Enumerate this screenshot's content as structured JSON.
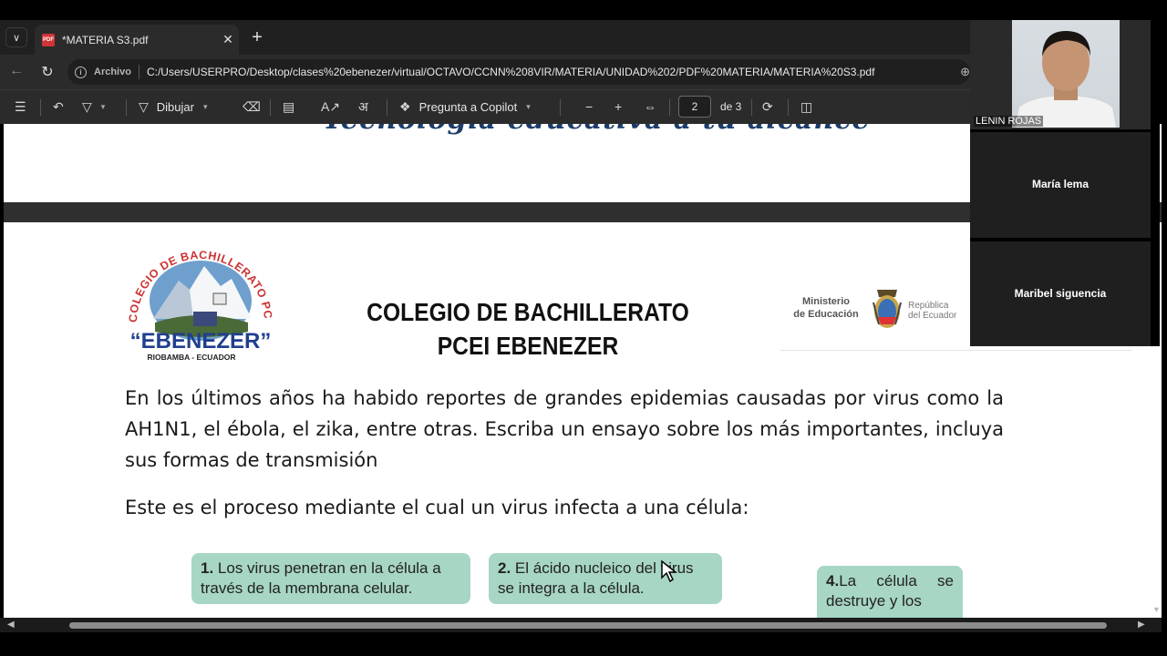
{
  "browser": {
    "tab_title": "*MATERIA S3.pdf",
    "pdf_favicon_text": "PDF",
    "url_scheme": "Archivo",
    "url": "C:/Users/USERPRO/Desktop/clases%20ebenezer/virtual/OCTAVO/CCNN%208VIR/MATERIA/UNIDAD%202/PDF%20MATERIA/MATERIA%20S3.pdf"
  },
  "pdf_toolbar": {
    "draw_label": "Dibujar",
    "copilot_label": "Pregunta a Copilot",
    "page_current": "2",
    "page_of": "de 3"
  },
  "document": {
    "prev_page_fragment": "Tecnología educativa a tu alcance",
    "school_title": "COLEGIO DE BACHILLERATO PCEI EBENEZER",
    "logo": {
      "arc_text": "COLEGIO DE BACHILLERATO PCEI",
      "name": "“EBENEZER”",
      "location": "RIOBAMBA - ECUADOR"
    },
    "ministry": {
      "line1": "Ministerio",
      "line2": "de Educación",
      "republic1": "República",
      "republic2": "del Ecuador"
    },
    "paragraph1": "En los últimos años ha habido reportes de grandes epidemias causadas por virus como la AH1N1, el ébola, el zika, entre otras. Escriba un ensayo sobre los más importantes, incluya sus formas de transmisión",
    "paragraph2": "Este es el proceso mediante el cual un virus infecta a una célula:",
    "steps": [
      {
        "num": "1.",
        "text": "Los virus penetran en la célula a través de la membrana celular."
      },
      {
        "num": "2.",
        "text": "El ácido nucleico del virus se integra a la célula."
      },
      {
        "num": "4.",
        "text": "La célula se destruye y los"
      }
    ]
  },
  "participants": [
    {
      "name": "LENIN ROJAS"
    },
    {
      "name": "María lema"
    },
    {
      "name": "Maribel siguencia"
    }
  ],
  "colors": {
    "step_box": "#a7d6c4",
    "chrome_dark": "#2b2b2b"
  }
}
